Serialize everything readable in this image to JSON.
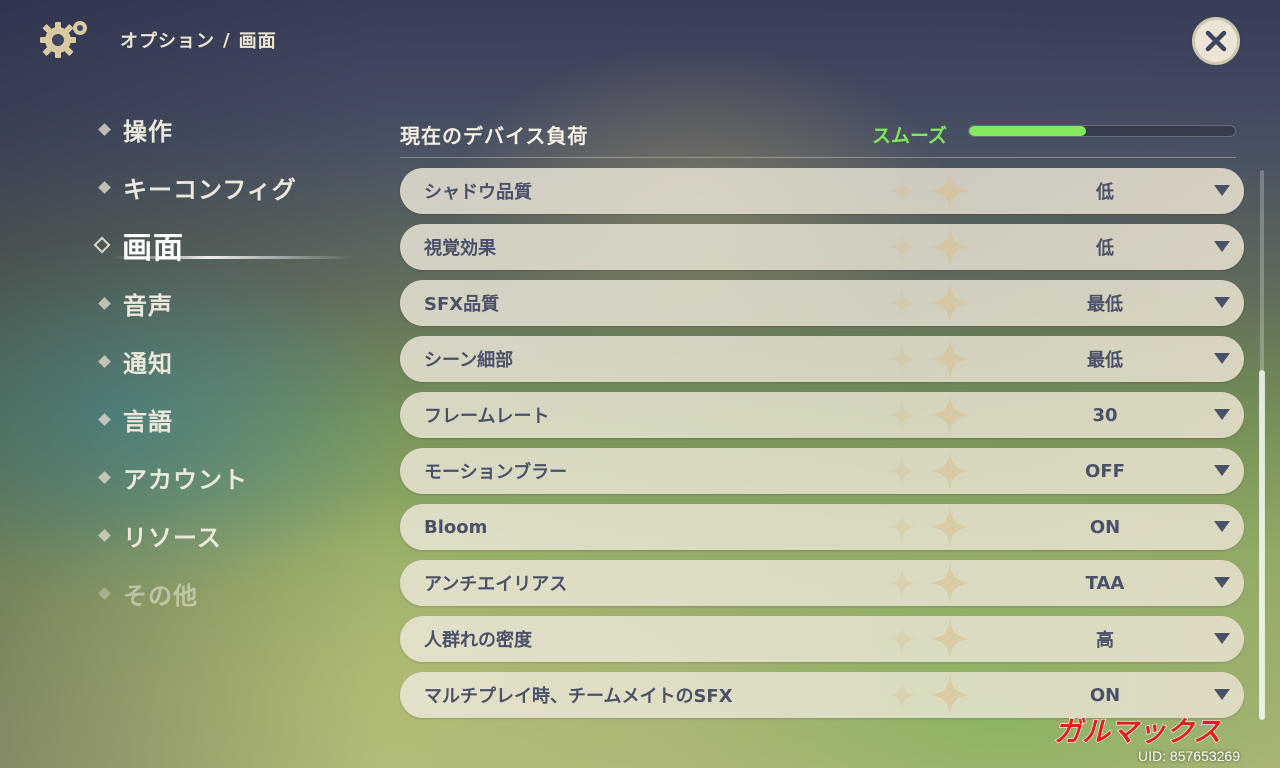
{
  "header": {
    "breadcrumb": [
      "オプション",
      "画面"
    ],
    "separator": "/",
    "icons": {
      "settings": "gear-icon",
      "close": "close-icon"
    }
  },
  "sidebar": {
    "items": [
      {
        "label": "操作",
        "state": "normal"
      },
      {
        "label": "キーコンフィグ",
        "state": "normal"
      },
      {
        "label": "画面",
        "state": "active"
      },
      {
        "label": "音声",
        "state": "normal"
      },
      {
        "label": "通知",
        "state": "normal"
      },
      {
        "label": "言語",
        "state": "normal"
      },
      {
        "label": "アカウント",
        "state": "normal"
      },
      {
        "label": "リソース",
        "state": "normal"
      },
      {
        "label": "その他",
        "state": "dim"
      }
    ]
  },
  "device_load": {
    "label": "現在のデバイス負荷",
    "status": "スムーズ",
    "level_fraction": 0.44,
    "status_color": "#7fe85a"
  },
  "settings": [
    {
      "label": "シャドウ品質",
      "value": "低"
    },
    {
      "label": "視覚効果",
      "value": "低"
    },
    {
      "label": "SFX品質",
      "value": "最低"
    },
    {
      "label": "シーン細部",
      "value": "最低"
    },
    {
      "label": "フレームレート",
      "value": "30"
    },
    {
      "label": "モーションブラー",
      "value": "OFF"
    },
    {
      "label": "Bloom",
      "value": "ON"
    },
    {
      "label": "アンチエイリアス",
      "value": "TAA"
    },
    {
      "label": "人群れの密度",
      "value": "高"
    },
    {
      "label": "マルチプレイ時、チームメイトのSFX",
      "value": "ON"
    }
  ],
  "watermark": "ガルマックス",
  "uid": "UID: 857653269",
  "colors": {
    "text_dark": "#4a5168",
    "text_light": "#ece8dc",
    "accent_green": "#86e85c",
    "watermark_red": "#e0201c"
  }
}
